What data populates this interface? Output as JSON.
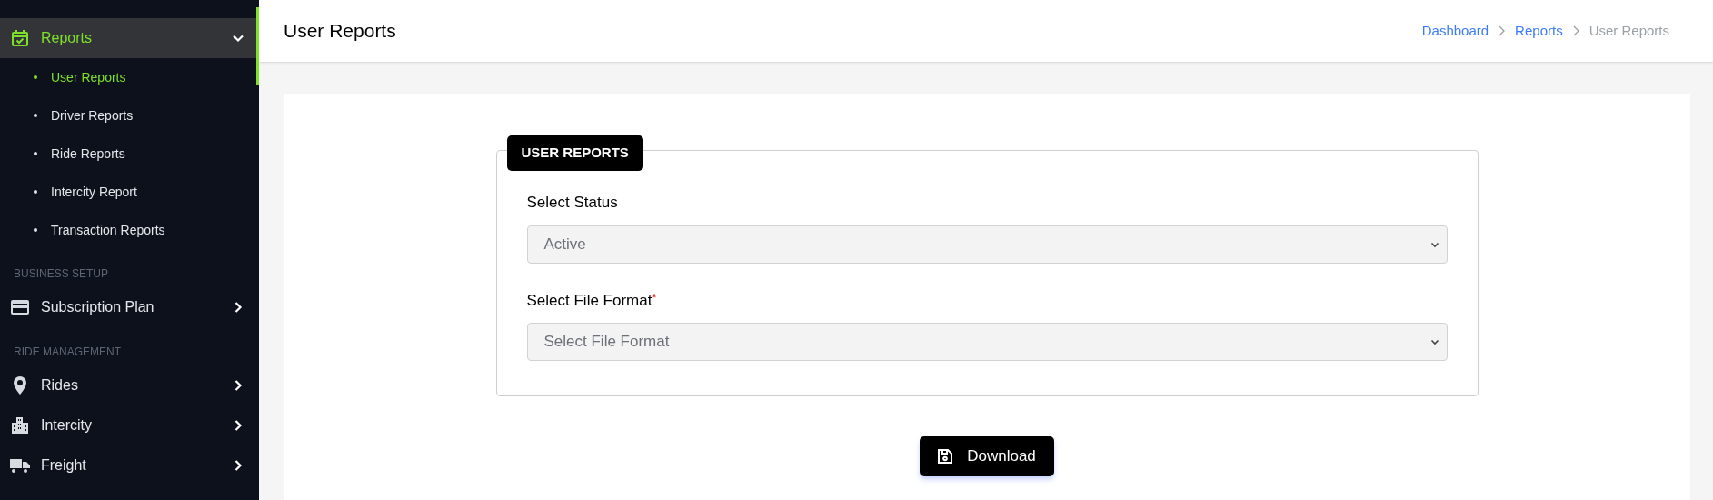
{
  "sidebar": {
    "sections": [
      {
        "items": [
          {
            "label": "Reports",
            "expanded": true,
            "selected": true,
            "children": [
              {
                "label": "User Reports",
                "selected": true
              },
              {
                "label": "Driver Reports",
                "selected": false
              },
              {
                "label": "Ride Reports",
                "selected": false
              },
              {
                "label": "Intercity Report",
                "selected": false
              },
              {
                "label": "Transaction Reports",
                "selected": false
              }
            ]
          }
        ]
      },
      {
        "header": "BUSINESS SETUP",
        "items": [
          {
            "label": "Subscription Plan",
            "expanded": false,
            "selected": false
          }
        ]
      },
      {
        "header": "RIDE MANAGEMENT",
        "items": [
          {
            "label": "Rides",
            "expanded": false,
            "selected": false
          },
          {
            "label": "Intercity",
            "expanded": false,
            "selected": false
          },
          {
            "label": "Freight",
            "expanded": false,
            "selected": false
          }
        ]
      }
    ]
  },
  "page_title": "User Reports",
  "breadcrumb": [
    {
      "label": "Dashboard",
      "current": false
    },
    {
      "label": "Reports",
      "current": false
    },
    {
      "label": "User Reports",
      "current": true
    }
  ],
  "form": {
    "legend": "USER REPORTS",
    "fields": [
      {
        "label": "Select Status",
        "value": "Active"
      },
      {
        "label": "Select File Format",
        "required_mark": "*",
        "value": "Select File Format"
      }
    ],
    "button": "Download"
  }
}
